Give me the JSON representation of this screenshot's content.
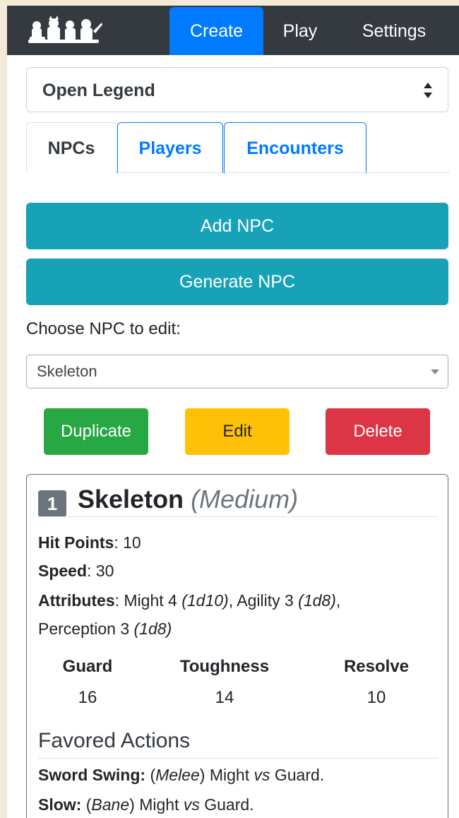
{
  "navbar": {
    "logo_icon": "monster-party-logo",
    "links": [
      "Create",
      "Play",
      "Settings"
    ],
    "active": "Create",
    "colors": {
      "bar": "#343a40",
      "active": "#007bff"
    }
  },
  "system_select": {
    "value": "Open Legend"
  },
  "tabs": [
    "NPCs",
    "Players",
    "Encounters"
  ],
  "buttons": {
    "add_npc": "Add NPC",
    "generate_npc": "Generate NPC",
    "duplicate": "Duplicate",
    "edit": "Edit",
    "delete": "Delete"
  },
  "choose_label": "Choose NPC to edit:",
  "npc_select": {
    "value": "Skeleton"
  },
  "npc": {
    "level": "1",
    "name": "Skeleton",
    "size": "(Medium)",
    "hit_points_label": "Hit Points",
    "hit_points": "10",
    "speed_label": "Speed",
    "speed": "30",
    "attributes_label": "Attributes",
    "attributes": [
      {
        "name": "Might",
        "score": "4",
        "dice": "(1d10)"
      },
      {
        "name": "Agility",
        "score": "3",
        "dice": "(1d8)"
      },
      {
        "name": "Perception",
        "score": "3",
        "dice": "(1d8)"
      }
    ],
    "defenses": [
      {
        "label": "Guard",
        "value": "16"
      },
      {
        "label": "Toughness",
        "value": "14"
      },
      {
        "label": "Resolve",
        "value": "10"
      }
    ],
    "favored_actions_label": "Favored Actions",
    "actions": [
      {
        "name": "Sword Swing:",
        "type": "Melee",
        "attr": "Might",
        "vs": "vs",
        "def": "Guard."
      },
      {
        "name": "Slow:",
        "type": "Bane",
        "attr": "Might",
        "vs": "vs",
        "def": "Guard."
      }
    ]
  }
}
